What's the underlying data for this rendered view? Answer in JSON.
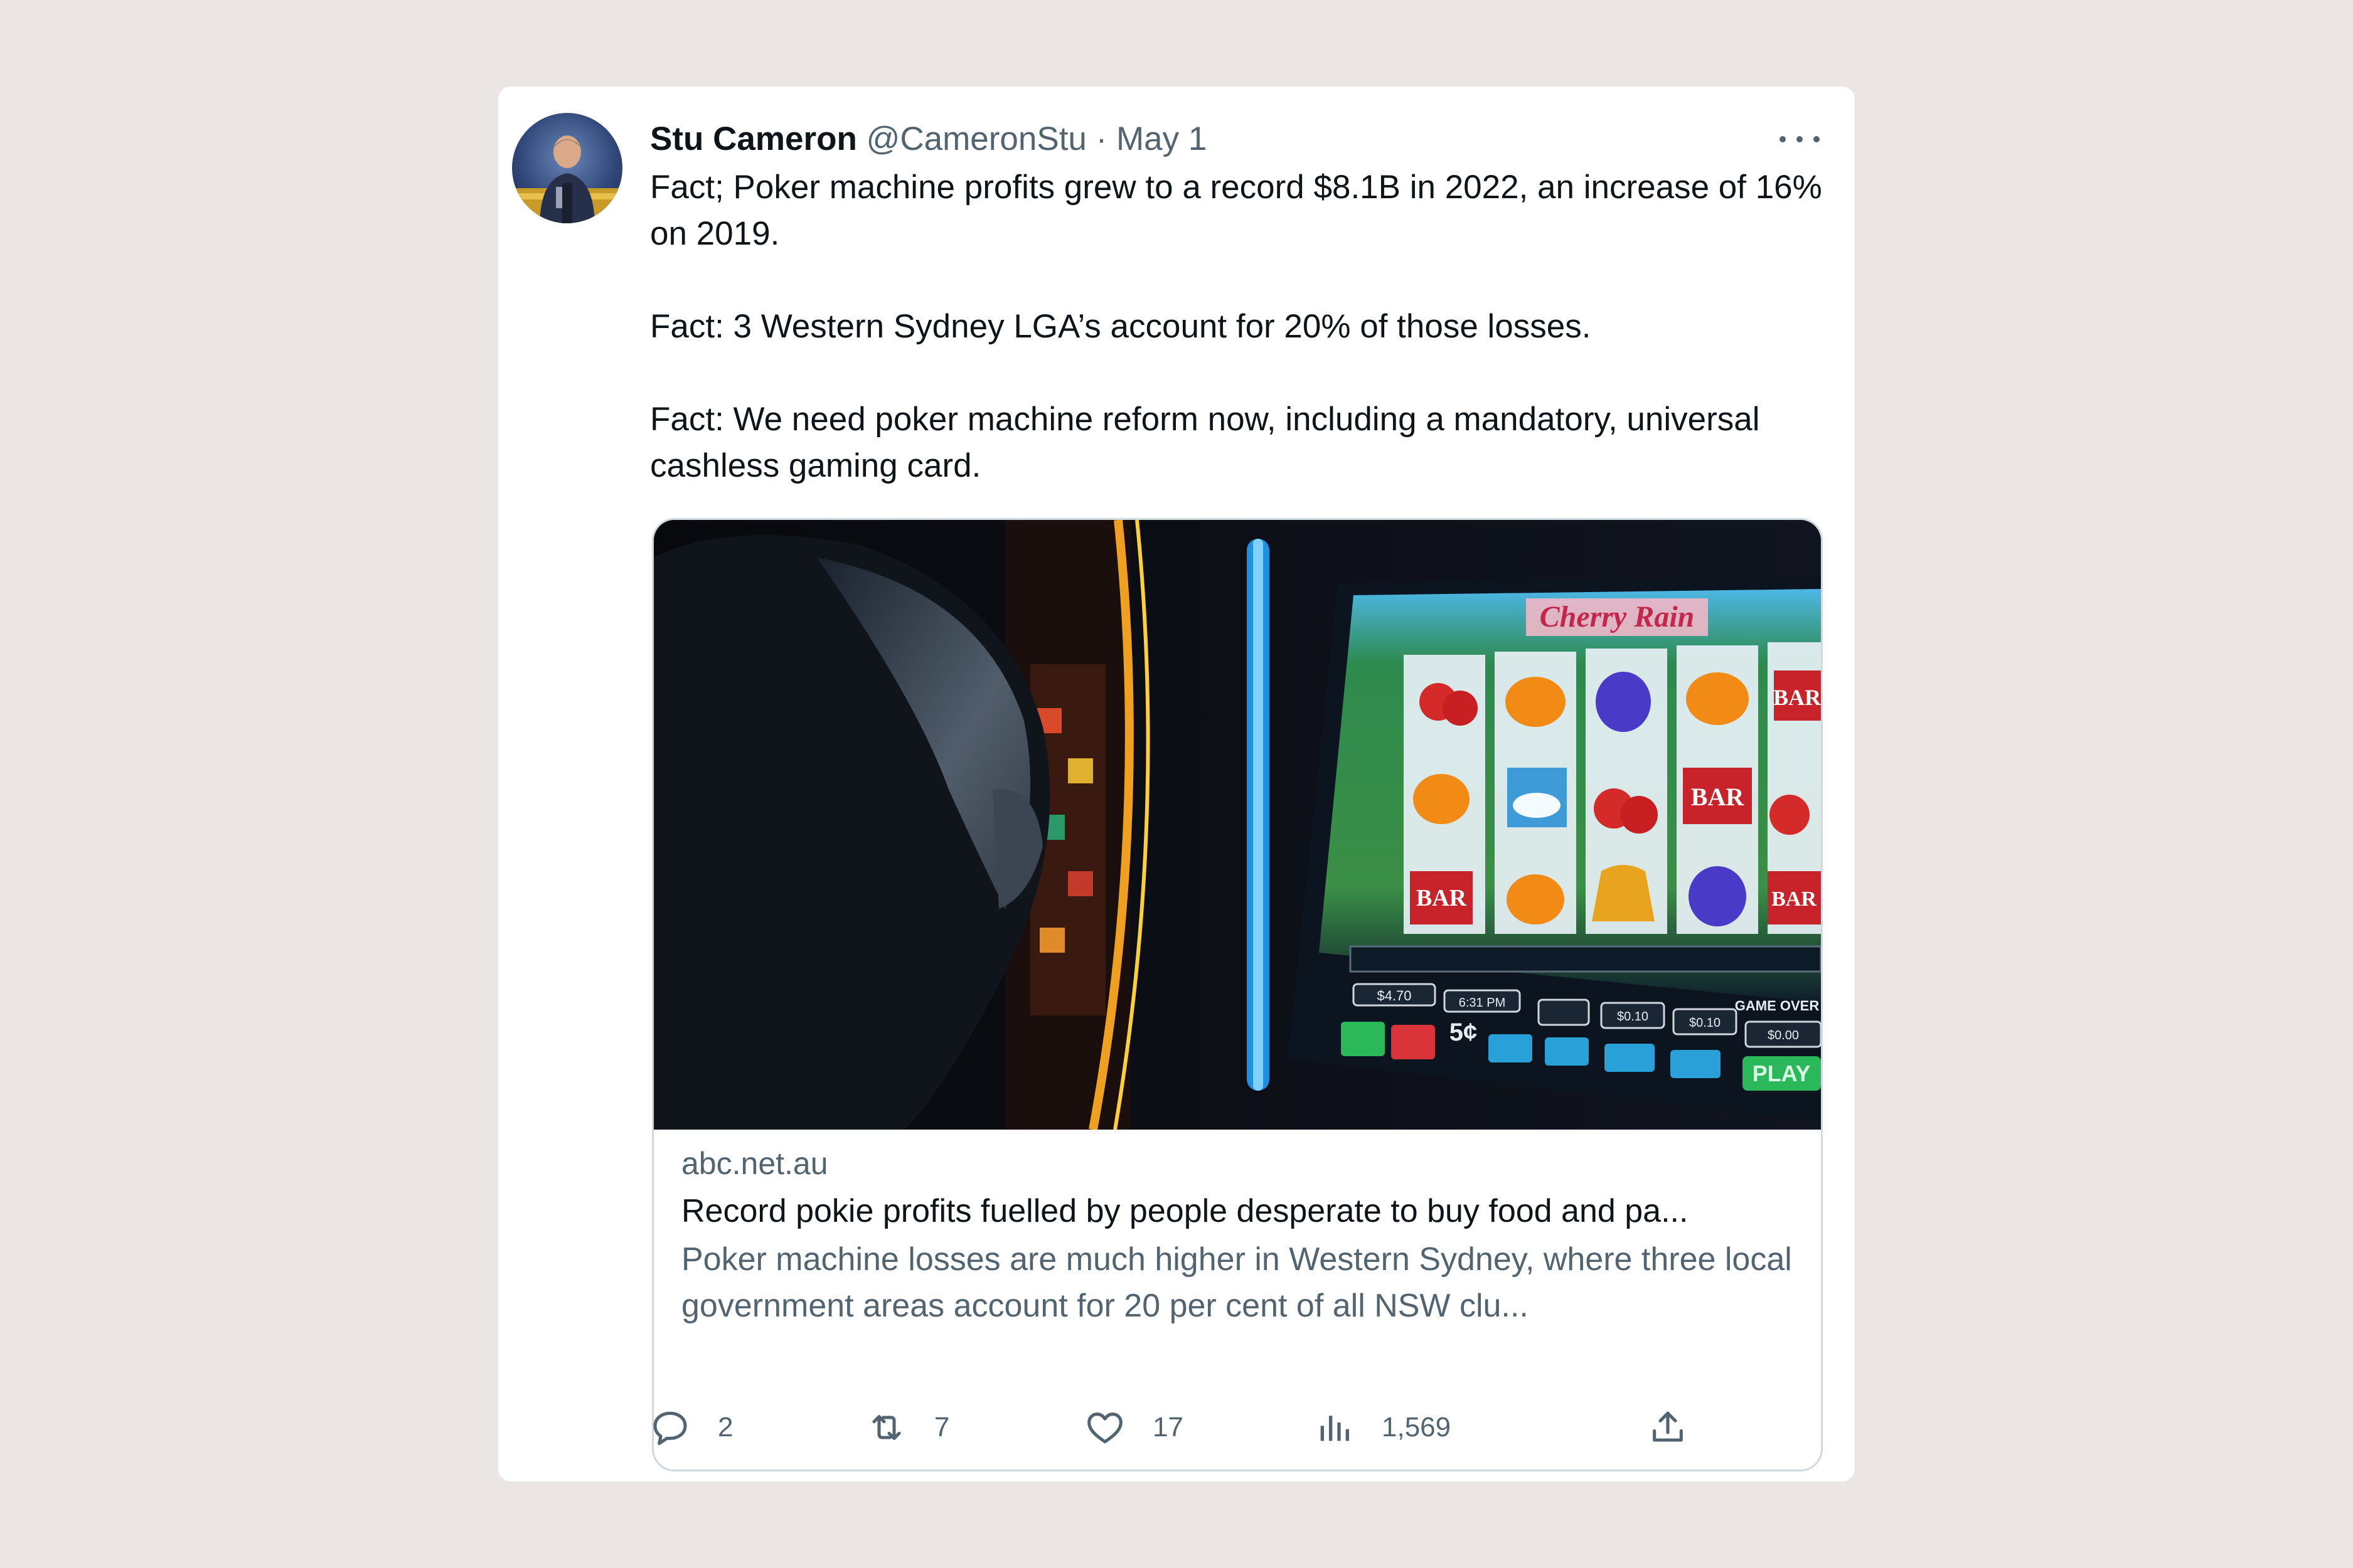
{
  "tweet": {
    "author_name": "Stu Cameron",
    "handle": "@CameronStu",
    "separator": "·",
    "date": "May 1",
    "paragraphs": [
      "Fact; Poker machine profits grew to a record $8.1B in 2022, an increase of 16% on 2019.",
      "Fact: 3 Western Sydney LGA’s account for 20% of those losses.",
      "Fact: We need poker machine reform now, including a mandatory, universal cashless gaming card."
    ]
  },
  "link_card": {
    "domain": "abc.net.au",
    "title": "Record pokie profits fuelled by people desperate to buy food and pa...",
    "description": "Poker machine losses are much higher in Western Sydney, where three local government areas account for 20 per cent of all NSW clu...",
    "image_screen_text": {
      "game_title": "Cherry Rain",
      "symbol_bar": "BAR",
      "play_button": "PLAY",
      "game_over": "GAME OVER",
      "credit": "$4.70",
      "time": "6:31 PM",
      "denomination": "5¢",
      "bets": [
        "$0.10",
        "$0.10",
        "$0.00"
      ]
    }
  },
  "actions": {
    "reply_count": "2",
    "retweet_count": "7",
    "like_count": "17",
    "views_count": "1,569"
  },
  "colors": {
    "background": "#ebe6e3",
    "card": "#ffffff",
    "text_primary": "#0f1419",
    "text_secondary": "#536471",
    "border": "#cfd9de"
  },
  "icons": [
    "more-icon",
    "reply-icon",
    "retweet-icon",
    "like-icon",
    "views-icon",
    "share-icon"
  ]
}
